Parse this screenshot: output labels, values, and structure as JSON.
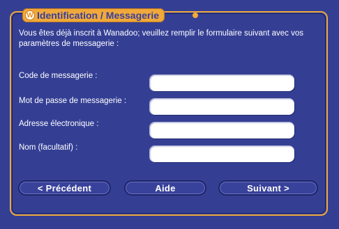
{
  "header": {
    "title": "Identification / Messagerie",
    "logo_icon": "wanadoo-logo-icon",
    "logo_glyph": "W"
  },
  "intro": {
    "text": "Vous êtes déjà inscrit à Wanadoo; veuillez remplir le formulaire suivant avec vos paramètres de messagerie :"
  },
  "form": {
    "fields": [
      {
        "label": "Code de messagerie :",
        "value": ""
      },
      {
        "label": "Mot de passe de messagerie :",
        "value": ""
      },
      {
        "label": "Adresse électronique :",
        "value": ""
      },
      {
        "label": "Nom (facultatif) :",
        "value": ""
      }
    ]
  },
  "buttons": {
    "previous": "< Précédent",
    "help": "Aide",
    "next": "Suivant >"
  },
  "colors": {
    "background": "#343f94",
    "accent": "#f0a93a",
    "text": "#ffffff",
    "title_text": "#3a3f9a"
  }
}
